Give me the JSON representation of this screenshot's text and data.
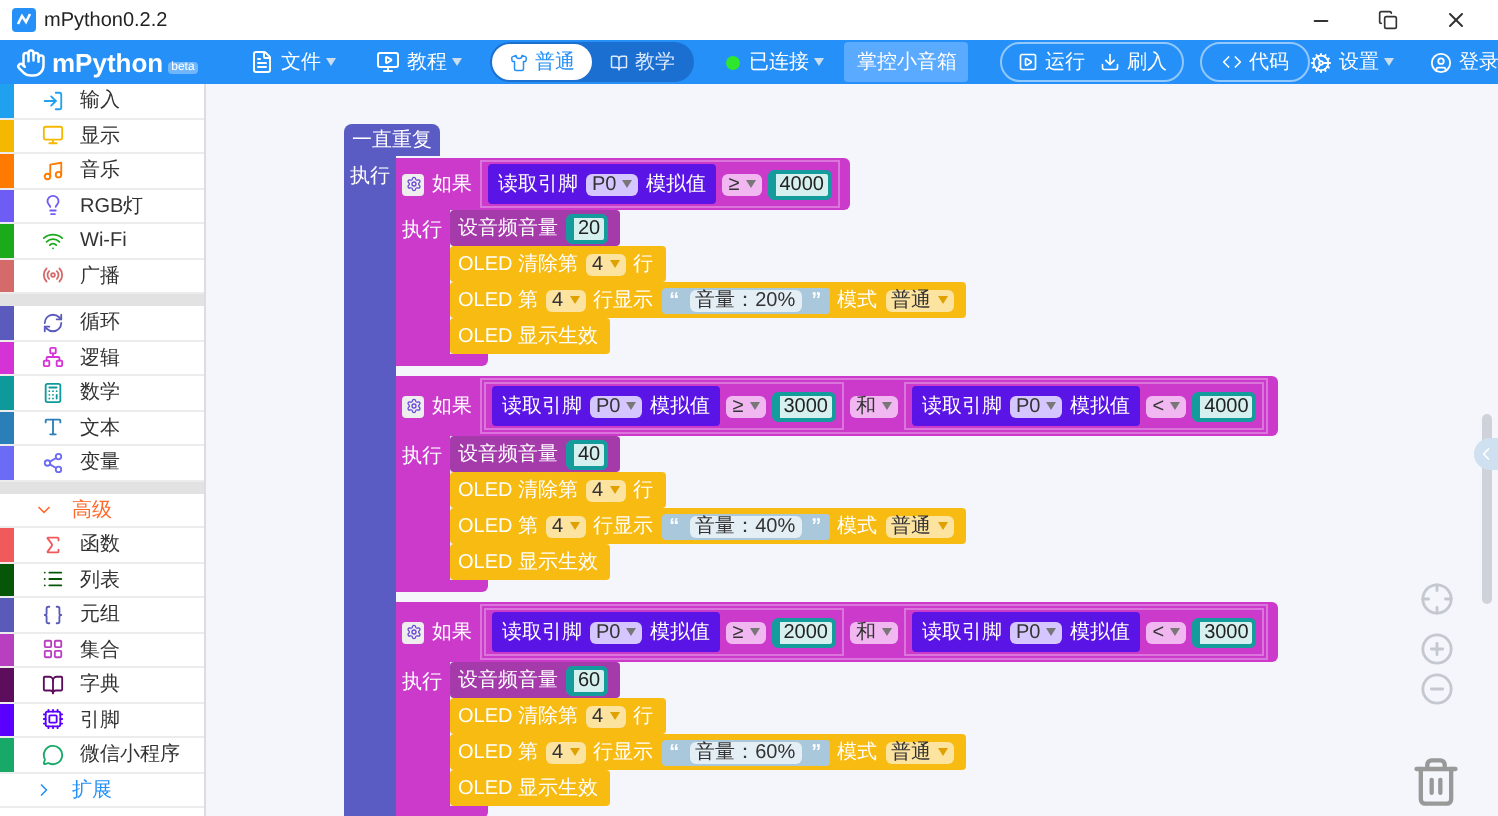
{
  "window": {
    "title": "mPython0.2.2"
  },
  "toolbar": {
    "logo": "mPython",
    "badge": "beta",
    "menus": [
      {
        "label": "文件"
      },
      {
        "label": "教程"
      }
    ],
    "modes": [
      {
        "label": "普通",
        "selected": true
      },
      {
        "label": "教学",
        "selected": false
      }
    ],
    "connection": {
      "label": "已连接",
      "connected": true
    },
    "device": "掌控小音箱",
    "actions": [
      {
        "label": "运行"
      },
      {
        "label": "刷入"
      }
    ],
    "code": "代码",
    "settings": "设置",
    "login": "登录"
  },
  "sidebar": {
    "groups": [
      {
        "items": [
          {
            "kind": "category",
            "label": "输入",
            "color": "#1fa1f0"
          },
          {
            "kind": "category",
            "label": "显示",
            "color": "#f5b800"
          },
          {
            "kind": "category",
            "label": "音乐",
            "color": "#ff7a00"
          },
          {
            "kind": "category",
            "label": "RGB灯",
            "color": "#6f5cf5"
          },
          {
            "kind": "category",
            "label": "Wi-Fi",
            "color": "#1aaa1a"
          },
          {
            "kind": "category",
            "label": "广播",
            "color": "#d46a6a"
          }
        ]
      },
      {
        "items": [
          {
            "kind": "category",
            "label": "循环",
            "color": "#5b5bbd"
          },
          {
            "kind": "category",
            "label": "逻辑",
            "color": "#d633d6"
          },
          {
            "kind": "category",
            "label": "数学",
            "color": "#0e9a9a"
          },
          {
            "kind": "category",
            "label": "文本",
            "color": "#2a7fb8"
          },
          {
            "kind": "category",
            "label": "变量",
            "color": "#6b6bf5"
          }
        ]
      },
      {
        "items": [
          {
            "kind": "toggle",
            "label": "高级",
            "expanded": true
          },
          {
            "kind": "category",
            "label": "函数",
            "color": "#f05a5a"
          },
          {
            "kind": "category",
            "label": "列表",
            "color": "#075507"
          },
          {
            "kind": "category",
            "label": "元组",
            "color": "#5a5ab8"
          },
          {
            "kind": "category",
            "label": "集合",
            "color": "#b840c0"
          },
          {
            "kind": "category",
            "label": "字典",
            "color": "#5c0d5c"
          },
          {
            "kind": "category",
            "label": "引脚",
            "color": "#5a00ff"
          },
          {
            "kind": "category",
            "label": "微信小程序",
            "color": "#18a868"
          },
          {
            "kind": "toggle",
            "label": "扩展",
            "expanded": false
          }
        ]
      }
    ]
  },
  "canvas": {
    "loop": {
      "label": "一直重复",
      "do": "执行",
      "branches": [
        {
          "label": "如果",
          "do": "执行",
          "conditions": [
            {
              "read": "读取引脚",
              "pin": "P0",
              "unit": "模拟值",
              "op": "≥",
              "value": "4000"
            }
          ],
          "statements": [
            {
              "kind": "volume",
              "label": "设音频音量",
              "value": "20"
            },
            {
              "kind": "clear",
              "label": "OLED 清除第",
              "row": "4",
              "suffix": "行"
            },
            {
              "kind": "show",
              "label": "OLED 第",
              "row": "4",
              "middle": "行显示",
              "open": "“",
              "text": "音量：20%",
              "close": "”",
              "mode_label": "模式",
              "mode": "普通"
            },
            {
              "kind": "commit",
              "label": "OLED 显示生效"
            }
          ]
        },
        {
          "label": "如果",
          "do": "执行",
          "join": "和",
          "conditions": [
            {
              "read": "读取引脚",
              "pin": "P0",
              "unit": "模拟值",
              "op": "≥",
              "value": "3000"
            },
            {
              "read": "读取引脚",
              "pin": "P0",
              "unit": "模拟值",
              "op": "<",
              "value": "4000"
            }
          ],
          "statements": [
            {
              "kind": "volume",
              "label": "设音频音量",
              "value": "40"
            },
            {
              "kind": "clear",
              "label": "OLED 清除第",
              "row": "4",
              "suffix": "行"
            },
            {
              "kind": "show",
              "label": "OLED 第",
              "row": "4",
              "middle": "行显示",
              "open": "“",
              "text": "音量：40%",
              "close": "”",
              "mode_label": "模式",
              "mode": "普通"
            },
            {
              "kind": "commit",
              "label": "OLED 显示生效"
            }
          ]
        },
        {
          "label": "如果",
          "do": "执行",
          "join": "和",
          "conditions": [
            {
              "read": "读取引脚",
              "pin": "P0",
              "unit": "模拟值",
              "op": "≥",
              "value": "2000"
            },
            {
              "read": "读取引脚",
              "pin": "P0",
              "unit": "模拟值",
              "op": "<",
              "value": "3000"
            }
          ],
          "statements": [
            {
              "kind": "volume",
              "label": "设音频音量",
              "value": "60"
            },
            {
              "kind": "clear",
              "label": "OLED 清除第",
              "row": "4",
              "suffix": "行"
            },
            {
              "kind": "show",
              "label": "OLED 第",
              "row": "4",
              "middle": "行显示",
              "open": "“",
              "text": "音量：60%",
              "close": "”",
              "mode_label": "模式",
              "mode": "普通"
            },
            {
              "kind": "commit",
              "label": "OLED 显示生效"
            }
          ]
        }
      ]
    }
  }
}
